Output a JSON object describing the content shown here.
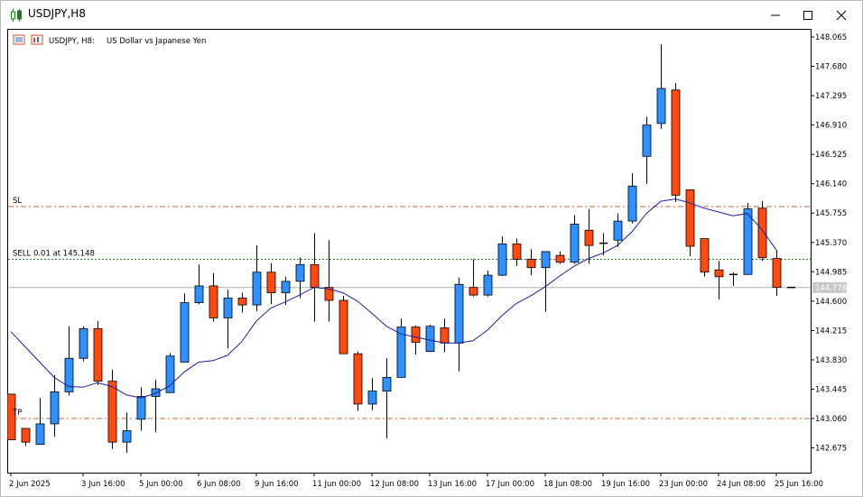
{
  "window": {
    "title": "USDJPY,H8",
    "icon": "candlestick-icon",
    "controls": [
      "minimize-icon",
      "maximize-icon",
      "close-icon"
    ]
  },
  "chart_header": {
    "symbol_period": "USDJPY, H8:",
    "description": "US Dollar vs Japanese Yen",
    "icons": [
      "one-click-trading-icon",
      "market-depth-icon"
    ]
  },
  "trade_lines": {
    "sl": {
      "label": "SL",
      "price": 145.84,
      "color": "#c26a3a"
    },
    "sell": {
      "label": "SELL 0.01 at 145.148",
      "price": 145.148,
      "color": "#2e7d32"
    },
    "tp": {
      "label": "TP",
      "price": 143.06,
      "color": "#c26a3a"
    },
    "bid": {
      "label": "144.778",
      "price": 144.778,
      "color": "#b0b0b0"
    }
  },
  "colors": {
    "bull": "#2f8fff",
    "bear": "#ff4a12",
    "ma": "#1c1c96",
    "wick": "#000000"
  },
  "chart_data": {
    "type": "candlestick",
    "ylim": [
      142.35,
      148.16
    ],
    "y_ticks": [
      "148.065",
      "147.680",
      "147.295",
      "146.910",
      "146.525",
      "146.140",
      "145.755",
      "145.370",
      "144.985",
      "144.600",
      "144.215",
      "143.830",
      "143.445",
      "143.060",
      "142.675"
    ],
    "x_ticks": [
      {
        "label": "2 Jun 2025",
        "i": 0
      },
      {
        "label": "3 Jun 16:00",
        "i": 5
      },
      {
        "label": "5 Jun 00:00",
        "i": 9
      },
      {
        "label": "6 Jun 08:00",
        "i": 13
      },
      {
        "label": "9 Jun 16:00",
        "i": 17
      },
      {
        "label": "11 Jun 00:00",
        "i": 21
      },
      {
        "label": "12 Jun 08:00",
        "i": 25
      },
      {
        "label": "13 Jun 16:00",
        "i": 29
      },
      {
        "label": "17 Jun 00:00",
        "i": 33
      },
      {
        "label": "18 Jun 08:00",
        "i": 37
      },
      {
        "label": "19 Jun 16:00",
        "i": 41
      },
      {
        "label": "23 Jun 00:00",
        "i": 45
      },
      {
        "label": "24 Jun 08:00",
        "i": 49
      },
      {
        "label": "25 Jun 16:00",
        "i": 53
      }
    ],
    "candles": [
      [
        143.38,
        143.38,
        142.98,
        142.78
      ],
      [
        142.93,
        142.82,
        142.7,
        142.75
      ],
      [
        142.72,
        143.33,
        142.72,
        142.99
      ],
      [
        142.99,
        143.63,
        142.82,
        143.41
      ],
      [
        143.41,
        144.27,
        143.36,
        143.85
      ],
      [
        143.85,
        144.27,
        143.81,
        144.24
      ],
      [
        144.24,
        144.34,
        143.5,
        143.55
      ],
      [
        143.55,
        143.7,
        142.66,
        142.75
      ],
      [
        142.75,
        143.14,
        142.61,
        142.9
      ],
      [
        143.05,
        143.47,
        142.9,
        143.35
      ],
      [
        143.35,
        143.57,
        142.88,
        143.45
      ],
      [
        143.4,
        143.92,
        143.4,
        143.88
      ],
      [
        143.8,
        144.7,
        143.8,
        144.58
      ],
      [
        144.58,
        145.08,
        144.56,
        144.8
      ],
      [
        144.8,
        144.97,
        144.33,
        144.38
      ],
      [
        144.38,
        144.75,
        143.98,
        144.64
      ],
      [
        144.64,
        144.71,
        144.45,
        144.55
      ],
      [
        144.55,
        145.33,
        144.47,
        144.98
      ],
      [
        144.98,
        145.1,
        144.56,
        144.71
      ],
      [
        144.71,
        144.92,
        144.55,
        144.86
      ],
      [
        144.86,
        145.17,
        144.64,
        145.08
      ],
      [
        145.08,
        145.49,
        144.33,
        144.78
      ],
      [
        144.78,
        145.4,
        144.33,
        144.61
      ],
      [
        144.61,
        144.67,
        143.94,
        143.91
      ],
      [
        143.91,
        143.94,
        143.16,
        143.25
      ],
      [
        143.25,
        143.59,
        143.17,
        143.42
      ],
      [
        143.42,
        143.85,
        142.8,
        143.6
      ],
      [
        143.6,
        144.37,
        143.6,
        144.26
      ],
      [
        144.26,
        144.28,
        143.9,
        144.06
      ],
      [
        143.94,
        144.29,
        143.93,
        144.27
      ],
      [
        144.25,
        144.37,
        143.93,
        144.05
      ],
      [
        144.05,
        144.91,
        143.68,
        144.82
      ],
      [
        144.78,
        145.15,
        144.66,
        144.68
      ],
      [
        144.68,
        145.0,
        144.66,
        144.94
      ],
      [
        144.94,
        145.45,
        144.93,
        145.35
      ],
      [
        145.35,
        145.42,
        145.06,
        145.15
      ],
      [
        145.15,
        145.28,
        144.94,
        145.04
      ],
      [
        145.04,
        145.2,
        144.46,
        145.25
      ],
      [
        145.2,
        145.25,
        145.09,
        145.11
      ],
      [
        145.11,
        145.73,
        145.09,
        145.61
      ],
      [
        145.53,
        145.81,
        145.09,
        145.33
      ],
      [
        145.35,
        145.49,
        145.2,
        145.36
      ],
      [
        145.4,
        145.75,
        145.31,
        145.65
      ],
      [
        145.65,
        146.28,
        145.62,
        146.11
      ],
      [
        146.5,
        147.02,
        146.14,
        146.91
      ],
      [
        146.93,
        147.97,
        146.86,
        147.39
      ],
      [
        147.37,
        147.46,
        145.9,
        145.99
      ],
      [
        146.06,
        146.05,
        145.19,
        145.32
      ],
      [
        145.42,
        145.41,
        144.92,
        144.98
      ],
      [
        145.01,
        145.13,
        144.62,
        144.92
      ],
      [
        144.93,
        144.98,
        144.8,
        144.95
      ],
      [
        144.95,
        145.89,
        144.95,
        145.81
      ],
      [
        145.82,
        145.91,
        145.13,
        145.17
      ],
      [
        145.16,
        145.27,
        144.67,
        144.78
      ],
      [
        144.78,
        144.78,
        144.77,
        144.78
      ]
    ],
    "ma": [
      144.2,
      144.0,
      143.8,
      143.6,
      143.48,
      143.47,
      143.53,
      143.48,
      143.37,
      143.33,
      143.39,
      143.49,
      143.67,
      143.8,
      143.82,
      143.89,
      144.07,
      144.34,
      144.51,
      144.59,
      144.68,
      144.78,
      144.76,
      144.71,
      144.6,
      144.44,
      144.27,
      144.17,
      144.13,
      144.09,
      144.05,
      144.05,
      144.08,
      144.22,
      144.41,
      144.57,
      144.67,
      144.79,
      144.93,
      145.06,
      145.16,
      145.23,
      145.33,
      145.51,
      145.75,
      145.91,
      145.94,
      145.89,
      145.82,
      145.77,
      145.72,
      145.75,
      145.54,
      145.27
    ]
  }
}
